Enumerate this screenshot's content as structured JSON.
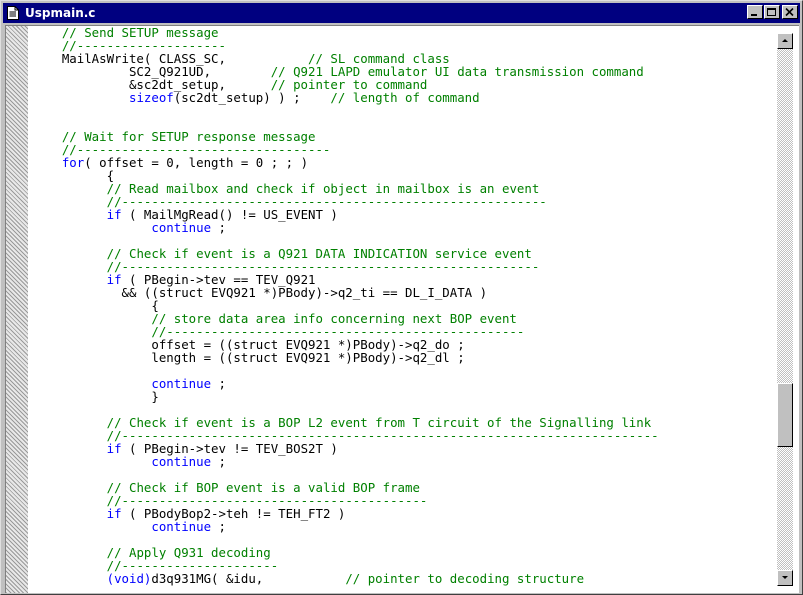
{
  "window": {
    "title": "Uspmain.c"
  },
  "icons": {
    "document": "document-icon",
    "minimize": "minimize-icon",
    "maximize": "maximize-icon",
    "close": "close-icon",
    "scroll_up": "arrow-up-icon",
    "scroll_down": "arrow-down-icon"
  },
  "colors": {
    "title_bar": "#000080",
    "comment": "#008000",
    "keyword": "#0000ff",
    "code_text": "#000000"
  },
  "code_lines": [
    [
      {
        "t": "    "
      },
      {
        "c": "cm",
        "t": "// Send SETUP message"
      }
    ],
    [
      {
        "t": "    "
      },
      {
        "c": "cm",
        "t": "//--------------------"
      }
    ],
    [
      {
        "t": "    MailAsWrite( CLASS_SC,           "
      },
      {
        "c": "cm",
        "t": "// SL command class"
      }
    ],
    [
      {
        "t": "             SC2_Q921UD,        "
      },
      {
        "c": "cm",
        "t": "// Q921 LAPD emulator UI data transmission command"
      }
    ],
    [
      {
        "t": "             &sc2dt_setup,      "
      },
      {
        "c": "cm",
        "t": "// pointer to command"
      }
    ],
    [
      {
        "t": "             "
      },
      {
        "c": "kw",
        "t": "sizeof"
      },
      {
        "t": "(sc2dt_setup) ) ;    "
      },
      {
        "c": "cm",
        "t": "// length of command"
      }
    ],
    [
      {
        "t": ""
      }
    ],
    [
      {
        "t": ""
      }
    ],
    [
      {
        "t": "    "
      },
      {
        "c": "cm",
        "t": "// Wait for SETUP response message"
      }
    ],
    [
      {
        "t": "    "
      },
      {
        "c": "cm",
        "t": "//----------------------------------"
      }
    ],
    [
      {
        "t": "    "
      },
      {
        "c": "kw",
        "t": "for"
      },
      {
        "t": "( offset = 0, length = 0 ; ; )"
      }
    ],
    [
      {
        "t": "          {"
      }
    ],
    [
      {
        "t": "          "
      },
      {
        "c": "cm",
        "t": "// Read mailbox and check if object in mailbox is an event"
      }
    ],
    [
      {
        "t": "          "
      },
      {
        "c": "cm",
        "t": "//---------------------------------------------------------"
      }
    ],
    [
      {
        "t": "          "
      },
      {
        "c": "kw",
        "t": "if"
      },
      {
        "t": " ( MailMgRead() != US_EVENT )"
      }
    ],
    [
      {
        "t": "                "
      },
      {
        "c": "kw",
        "t": "continue"
      },
      {
        "t": " ;"
      }
    ],
    [
      {
        "t": ""
      }
    ],
    [
      {
        "t": "          "
      },
      {
        "c": "cm",
        "t": "// Check if event is a Q921 DATA INDICATION service event"
      }
    ],
    [
      {
        "t": "          "
      },
      {
        "c": "cm",
        "t": "//--------------------------------------------------------"
      }
    ],
    [
      {
        "t": "          "
      },
      {
        "c": "kw",
        "t": "if"
      },
      {
        "t": " ( PBegin->tev == TEV_Q921"
      }
    ],
    [
      {
        "t": "            && ((struct EVQ921 *)PBody)->q2_ti == DL_I_DATA )"
      }
    ],
    [
      {
        "t": "                {"
      }
    ],
    [
      {
        "t": "                "
      },
      {
        "c": "cm",
        "t": "// store data area info concerning next BOP event"
      }
    ],
    [
      {
        "t": "                "
      },
      {
        "c": "cm",
        "t": "//------------------------------------------------"
      }
    ],
    [
      {
        "t": "                offset = ((struct EVQ921 *)PBody)->q2_do ;"
      }
    ],
    [
      {
        "t": "                length = ((struct EVQ921 *)PBody)->q2_dl ;"
      }
    ],
    [
      {
        "t": ""
      }
    ],
    [
      {
        "t": "                "
      },
      {
        "c": "kw",
        "t": "continue"
      },
      {
        "t": " ;"
      }
    ],
    [
      {
        "t": "                }"
      }
    ],
    [
      {
        "t": ""
      }
    ],
    [
      {
        "t": "          "
      },
      {
        "c": "cm",
        "t": "// Check if event is a BOP L2 event from T circuit of the Signalling link"
      }
    ],
    [
      {
        "t": "          "
      },
      {
        "c": "cm",
        "t": "//------------------------------------------------------------------------"
      }
    ],
    [
      {
        "t": "          "
      },
      {
        "c": "kw",
        "t": "if"
      },
      {
        "t": " ( PBegin->tev != TEV_BOS2T )"
      }
    ],
    [
      {
        "t": "                "
      },
      {
        "c": "kw",
        "t": "continue"
      },
      {
        "t": " ;"
      }
    ],
    [
      {
        "t": ""
      }
    ],
    [
      {
        "t": "          "
      },
      {
        "c": "cm",
        "t": "// Check if BOP event is a valid BOP frame"
      }
    ],
    [
      {
        "t": "          "
      },
      {
        "c": "cm",
        "t": "//-----------------------------------------"
      }
    ],
    [
      {
        "t": "          "
      },
      {
        "c": "kw",
        "t": "if"
      },
      {
        "t": " ( PBodyBop2->teh != TEH_FT2 )"
      }
    ],
    [
      {
        "t": "                "
      },
      {
        "c": "kw",
        "t": "continue"
      },
      {
        "t": " ;"
      }
    ],
    [
      {
        "t": ""
      }
    ],
    [
      {
        "t": "          "
      },
      {
        "c": "cm",
        "t": "// Apply Q931 decoding"
      }
    ],
    [
      {
        "t": "          "
      },
      {
        "c": "cm",
        "t": "//---------------------"
      }
    ],
    [
      {
        "t": "          "
      },
      {
        "c": "kw",
        "t": "(void)"
      },
      {
        "t": "d3q931MG( &idu,           "
      },
      {
        "c": "cm",
        "t": "// pointer to decoding structure"
      }
    ]
  ]
}
